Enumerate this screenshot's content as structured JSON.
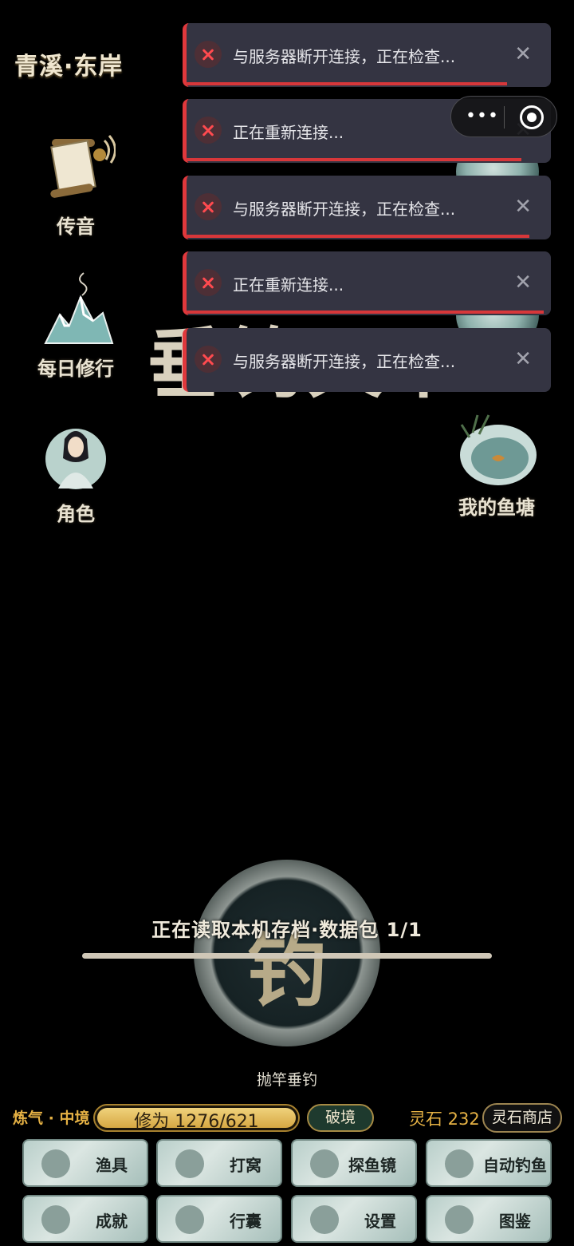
{
  "location_title": "青溪·东岸",
  "side_menu": [
    {
      "label": "传音",
      "icon": "scroll-bell-icon"
    },
    {
      "label": "每日修行",
      "icon": "mountain-incense-icon"
    },
    {
      "label": "角色",
      "icon": "character-portrait-icon"
    }
  ],
  "right_menu": [
    {
      "label": "我的鱼塘",
      "icon": "fish-pond-icon"
    }
  ],
  "background_title": "垂钓天下",
  "toasts": [
    {
      "message": "与服务器断开连接，正在检查...",
      "progress": 0.88
    },
    {
      "message": "正在重新连接...",
      "progress": 0.92
    },
    {
      "message": "与服务器断开连接，正在检查...",
      "progress": 0.94
    },
    {
      "message": "正在重新连接...",
      "progress": 0.98
    },
    {
      "message": "与服务器断开连接，正在检查...",
      "progress": 0.0
    }
  ],
  "capsule": {
    "menu_icon": "more-dots-icon",
    "close_icon": "target-circle-icon"
  },
  "fishing": {
    "button_glyph": "钓",
    "loading_text": "正在读取本机存档·数据包 1/1",
    "loading_progress": 1.0,
    "cast_label": "抛竿垂钓"
  },
  "status": {
    "realm": "炼气 · 中境",
    "cultivation_text": "修为 1276/621",
    "cultivation_progress": 1.0,
    "breakthrough_label": "破境",
    "spirit_stones": "灵石 232",
    "shop_label": "灵石商店"
  },
  "bottom_buttons": [
    {
      "label": "渔具",
      "icon": "fishing-gear-icon"
    },
    {
      "label": "打窝",
      "icon": "bait-icon"
    },
    {
      "label": "探鱼镜",
      "icon": "mirror-icon"
    },
    {
      "label": "自动钓鱼",
      "icon": "fishing-rod-icon"
    },
    {
      "label": "成就",
      "icon": "book-icon"
    },
    {
      "label": "行囊",
      "icon": "bag-icon"
    },
    {
      "label": "设置",
      "icon": "gear-icon"
    },
    {
      "label": "图鉴",
      "icon": "catalog-book-icon"
    }
  ],
  "colors": {
    "error": "#e0383c",
    "gold": "#e5b144",
    "toast_bg": "#343442"
  }
}
